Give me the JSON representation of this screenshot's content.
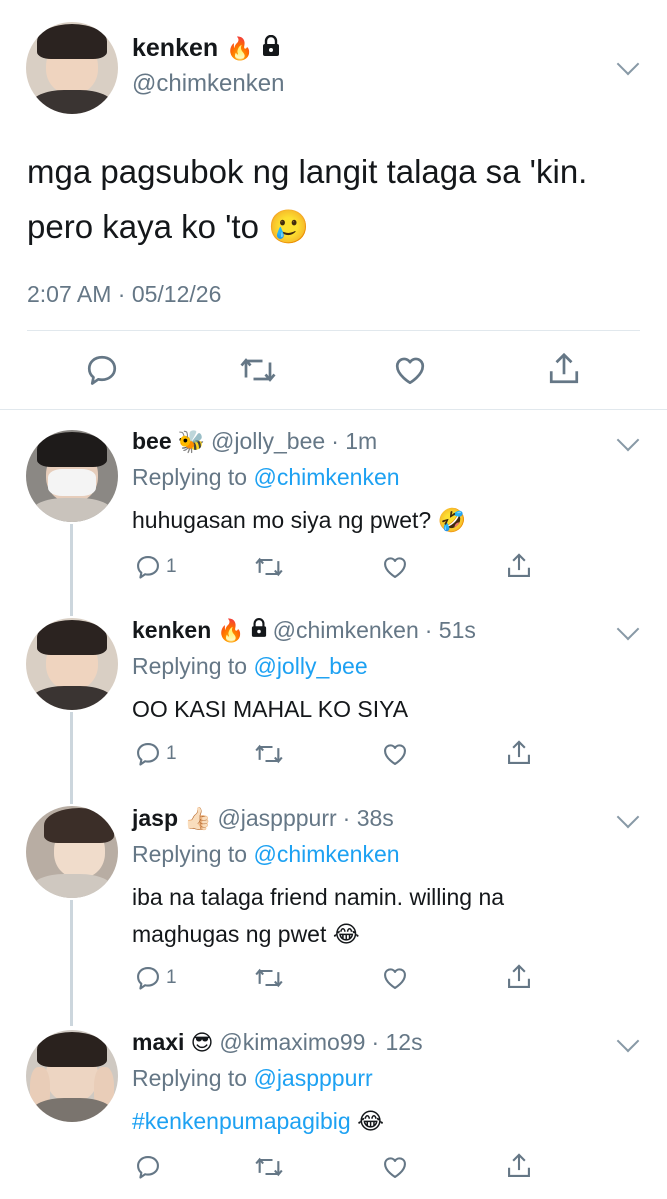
{
  "colors": {
    "link": "#1da1f2",
    "muted": "#657786",
    "text": "#14171a",
    "divider": "#e1e8ed"
  },
  "main": {
    "name": "kenken",
    "emoji": "🔥",
    "lock_icon": "lock-icon",
    "handle": "@chimkenken",
    "text_line1": "mga pagsubok ng langit talaga sa 'kin.",
    "text_line2": "pero kaya ko 'to",
    "text_emoji": "🥲",
    "timestamp": "2:07 AM · 05/12/26"
  },
  "replies": [
    {
      "name": "bee",
      "emoji": "🐝",
      "handle": "@jolly_bee",
      "time": "· 1m",
      "replying_prefix": "Replying to",
      "replying_to": "@chimkenken",
      "text": "huhugasan mo siya ng pwet?",
      "text_emoji": "🤣",
      "reply_count": "1"
    },
    {
      "name": "kenken",
      "emoji": "🔥",
      "handle": "@chimkenken",
      "time": "· 51s",
      "replying_prefix": "Replying to",
      "replying_to": "@jolly_bee",
      "text": "OO KASI MAHAL KO SIYA",
      "reply_count": "1"
    },
    {
      "name": "jasp",
      "emoji": "👍🏻",
      "handle": "@jaspppurr",
      "time": "· 38s",
      "replying_prefix": "Replying to",
      "replying_to": "@chimkenken",
      "text_line1": "iba na talaga friend namin. willing na",
      "text_line2": "maghugas ng pwet",
      "text_emoji": "😂",
      "reply_count": "1"
    },
    {
      "name": "maxi",
      "emoji": "😎",
      "handle": "@kimaximo99",
      "time": "· 12s",
      "replying_prefix": "Replying to",
      "replying_to": "@jaspppurr",
      "text": "#kenkenpumapagibig",
      "text_emoji": "😂"
    }
  ]
}
